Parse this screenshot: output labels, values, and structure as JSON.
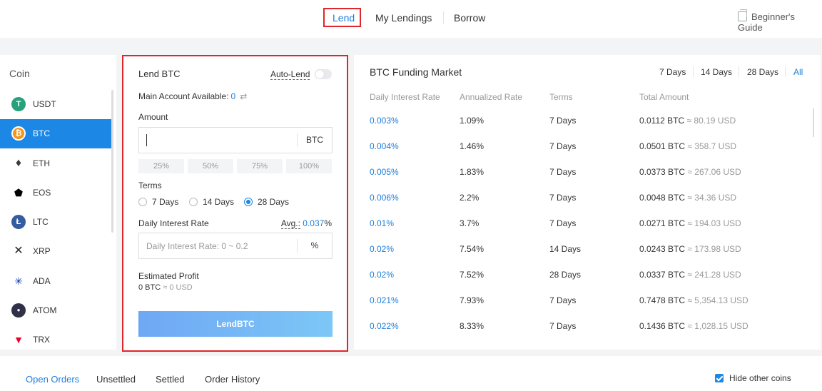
{
  "nav": {
    "tabs": [
      "Lend",
      "My Lendings",
      "Borrow"
    ],
    "active": "Lend",
    "guide": "Beginner's Guide"
  },
  "coins": {
    "header": "Coin",
    "items": [
      {
        "symbol": "USDT",
        "icon": "tether-icon",
        "color": "#26a17b",
        "glyph": "T"
      },
      {
        "symbol": "BTC",
        "icon": "bitcoin-icon",
        "color": "#f7931a",
        "glyph": "₿"
      },
      {
        "symbol": "ETH",
        "icon": "ethereum-icon",
        "color": "#3c3c3d",
        "glyph": "♦"
      },
      {
        "symbol": "EOS",
        "icon": "eos-icon",
        "color": "#000000",
        "glyph": "▲"
      },
      {
        "symbol": "LTC",
        "icon": "litecoin-icon",
        "color": "#345d9d",
        "glyph": "Ł"
      },
      {
        "symbol": "XRP",
        "icon": "ripple-icon",
        "color": "#23292f",
        "glyph": "✕"
      },
      {
        "symbol": "ADA",
        "icon": "cardano-icon",
        "color": "#0033ad",
        "glyph": "✳"
      },
      {
        "symbol": "ATOM",
        "icon": "cosmos-icon",
        "color": "#2e3148",
        "glyph": "●"
      },
      {
        "symbol": "TRX",
        "icon": "tron-icon",
        "color": "#ef0027",
        "glyph": "▼"
      }
    ],
    "selected": "BTC"
  },
  "lend": {
    "title": "Lend BTC",
    "auto_lend": "Auto-Lend",
    "available_label": "Main Account Available:",
    "available_value": "0",
    "amount_label": "Amount",
    "amount_unit": "BTC",
    "percents": [
      "25%",
      "50%",
      "75%",
      "100%"
    ],
    "terms_label": "Terms",
    "terms": [
      "7 Days",
      "14 Days",
      "28 Days"
    ],
    "selected_term": "28 Days",
    "rate_label": "Daily Interest Rate",
    "avg_label": "Avg.:",
    "avg_value": "0.037",
    "avg_unit": "%",
    "rate_placeholder": "Daily Interest Rate: 0 ~ 0.2",
    "rate_unit": "%",
    "profit_label": "Estimated Profit",
    "profit_btc": "0 BTC",
    "profit_usd": "≈ 0 USD",
    "button": "LendBTC"
  },
  "market": {
    "title": "BTC Funding Market",
    "tabs": [
      "7 Days",
      "14 Days",
      "28 Days",
      "All"
    ],
    "active_tab": "All",
    "columns": [
      "Daily Interest Rate",
      "Annualized Rate",
      "Terms",
      "Total Amount"
    ],
    "rows": [
      {
        "rate": "0.003%",
        "annual": "1.09%",
        "term": "7 Days",
        "btc": "0.0112 BTC",
        "usd": "≈ 80.19 USD"
      },
      {
        "rate": "0.004%",
        "annual": "1.46%",
        "term": "7 Days",
        "btc": "0.0501 BTC",
        "usd": "≈ 358.7 USD"
      },
      {
        "rate": "0.005%",
        "annual": "1.83%",
        "term": "7 Days",
        "btc": "0.0373 BTC",
        "usd": "≈ 267.06 USD"
      },
      {
        "rate": "0.006%",
        "annual": "2.2%",
        "term": "7 Days",
        "btc": "0.0048 BTC",
        "usd": "≈ 34.36 USD"
      },
      {
        "rate": "0.01%",
        "annual": "3.7%",
        "term": "7 Days",
        "btc": "0.0271 BTC",
        "usd": "≈ 194.03 USD"
      },
      {
        "rate": "0.02%",
        "annual": "7.54%",
        "term": "14 Days",
        "btc": "0.0243 BTC",
        "usd": "≈ 173.98 USD"
      },
      {
        "rate": "0.02%",
        "annual": "7.52%",
        "term": "28 Days",
        "btc": "0.0337 BTC",
        "usd": "≈ 241.28 USD"
      },
      {
        "rate": "0.021%",
        "annual": "7.93%",
        "term": "7 Days",
        "btc": "0.7478 BTC",
        "usd": "≈ 5,354.13 USD"
      },
      {
        "rate": "0.022%",
        "annual": "8.33%",
        "term": "7 Days",
        "btc": "0.1436 BTC",
        "usd": "≈ 1,028.15 USD"
      }
    ]
  },
  "orders": {
    "tabs": [
      "Open Orders",
      "Unsettled",
      "Settled",
      "Order History"
    ],
    "active": "Open Orders",
    "hide_other": "Hide other coins",
    "hide_checked": true
  },
  "colors": {
    "accent": "#1f7ddb",
    "highlight": "#e0262a",
    "selected_row": "#1c87e5"
  }
}
